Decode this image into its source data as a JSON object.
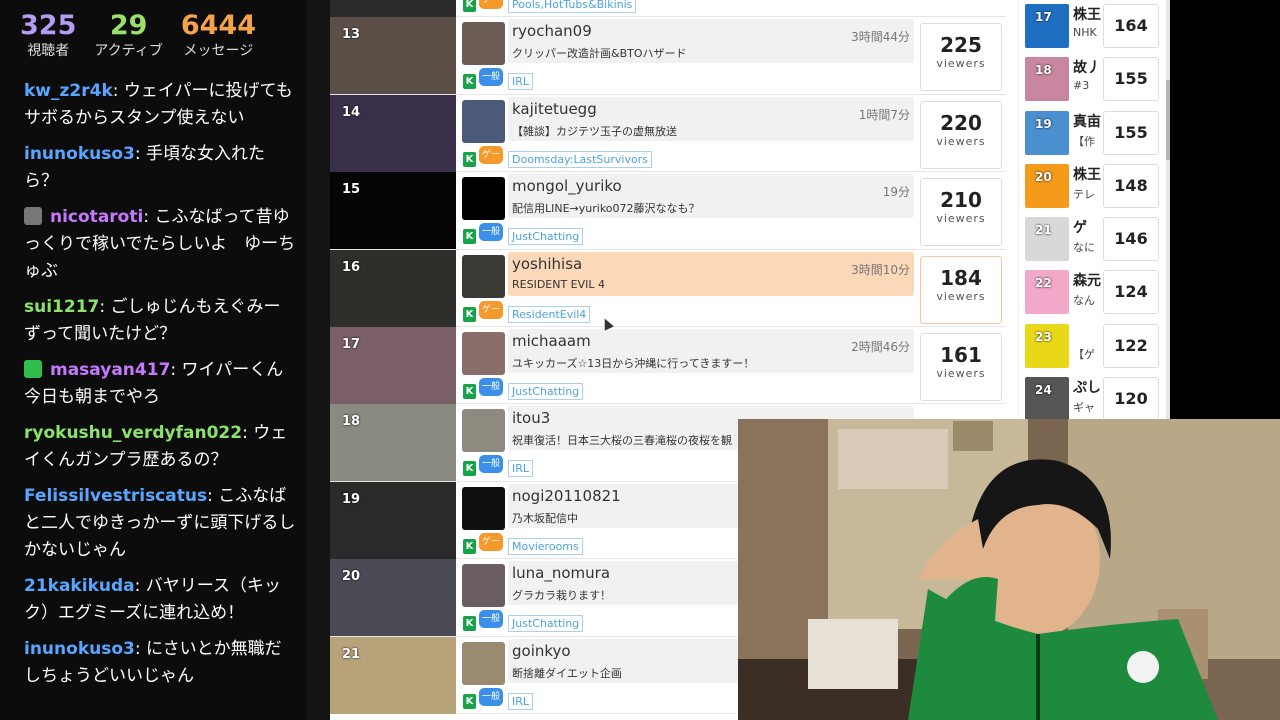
{
  "stats": [
    {
      "value": "325",
      "label": "視聴者",
      "color": "#b49cf2"
    },
    {
      "value": "29",
      "label": "アクティブ",
      "color": "#9be06a"
    },
    {
      "value": "6444",
      "label": "メッセージ",
      "color": "#f5a24b"
    }
  ],
  "chat": [
    {
      "user": "kw_z2r4k",
      "color": "#58a6ff",
      "text": "ウェイパーに投げてもサボるからスタンプ使えない"
    },
    {
      "user": "inunokuso3",
      "color": "#58a6ff",
      "text": "手頃な女入れたら？"
    },
    {
      "user": "nicotaroti",
      "color": "#c678ff",
      "text": "こふなばって昔ゆっくりで稼いでたらしいよ　ゆーちゅぶ",
      "icon": "avatar-icon"
    },
    {
      "user": "sui1217",
      "color": "#8be36a",
      "text": "ごしゅじんもえぐみーずって聞いたけど？"
    },
    {
      "user": "masayan417",
      "color": "#c678ff",
      "text": "ワイパーくん今日も朝までやろ",
      "icon": "gift-icon"
    },
    {
      "user": "ryokushu_verdyfan022",
      "color": "#8be36a",
      "text": "ウェイくんガンプラ歴あるの？"
    },
    {
      "user": "Felissilvestriscatus",
      "color": "#58a6ff",
      "text": "こふなばと二人でゆきっかーずに頭下げるしかないじゃん"
    },
    {
      "user": "21kakikuda",
      "color": "#58a6ff",
      "text": "バヤリース（キック）エグミーズに連れ込め！"
    },
    {
      "user": "inunokuso3",
      "color": "#58a6ff",
      "text": "にさいとか無職だしちょうどいいじゃん"
    }
  ],
  "streams": [
    {
      "rank": "",
      "name": "",
      "title": "",
      "duration": "",
      "tag": "Pools,HotTubs&Bikinis",
      "cat": "ゲーム",
      "cat_color": "orange",
      "viewers": "",
      "thumb": "#2b2b2b",
      "avatar": "#7a6455",
      "highlight": false
    },
    {
      "rank": "13",
      "name": "ryochan09",
      "title": "クリッパー改造計画&BTOハザード",
      "duration": "3時間44分",
      "tag": "IRL",
      "cat": "一般",
      "cat_color": "blue",
      "viewers": "225",
      "thumb": "#5c4f48",
      "avatar": "#6b5c55",
      "highlight": false
    },
    {
      "rank": "14",
      "name": "kajitetuegg",
      "title": "【雑談】カジテツ玉子の虚無放送",
      "duration": "1時間7分",
      "tag": "Doomsday:LastSurvivors",
      "cat": "ゲーム",
      "cat_color": "orange",
      "viewers": "220",
      "thumb": "#3a2f4a",
      "avatar": "#4a5a78",
      "highlight": false
    },
    {
      "rank": "15",
      "name": "mongol_yuriko",
      "title": "配信用LINE→yuriko072藤沢ななも？",
      "duration": "19分",
      "tag": "JustChatting",
      "cat": "一般",
      "cat_color": "blue",
      "viewers": "210",
      "thumb": "#050505",
      "avatar": "#000000",
      "highlight": false
    },
    {
      "rank": "16",
      "name": "yoshihisa",
      "title": "RESIDENT EVIL 4",
      "duration": "3時間10分",
      "tag": "ResidentEvil4",
      "cat": "ゲーム",
      "cat_color": "orange",
      "viewers": "184",
      "thumb": "#2e2e2a",
      "avatar": "#3a3a35",
      "highlight": true
    },
    {
      "rank": "17",
      "name": "michaaam",
      "title": "ユキッカーズ☆13日から沖縄に行ってきますー！",
      "duration": "2時間46分",
      "tag": "JustChatting",
      "cat": "一般",
      "cat_color": "blue",
      "viewers": "161",
      "thumb": "#7a5f66",
      "avatar": "#8a6e6a",
      "highlight": false
    },
    {
      "rank": "18",
      "name": "itou3",
      "title": "祝車復活！日本三大桜の三春滝桜の夜桜を観",
      "duration": "",
      "tag": "IRL",
      "cat": "一般",
      "cat_color": "blue",
      "viewers": "",
      "thumb": "#8a8a80",
      "avatar": "#8e8a80",
      "highlight": false
    },
    {
      "rank": "19",
      "name": "nogi20110821",
      "title": "乃木坂配信中",
      "duration": "",
      "tag": "Movierooms",
      "cat": "ゲーム",
      "cat_color": "orange",
      "viewers": "",
      "thumb": "#2a2a2a",
      "avatar": "#101010",
      "highlight": false
    },
    {
      "rank": "20",
      "name": "luna_nomura",
      "title": "グラカラ栽ります！",
      "duration": "",
      "tag": "JustChatting",
      "cat": "一般",
      "cat_color": "blue",
      "viewers": "",
      "thumb": "#4a4a55",
      "avatar": "#6a5e60",
      "highlight": false
    },
    {
      "rank": "21",
      "name": "goinkyo",
      "title": "断捨離ダイエット企画",
      "duration": "",
      "tag": "IRL",
      "cat": "一般",
      "cat_color": "blue",
      "viewers": "",
      "thumb": "#b8a27a",
      "avatar": "#9a8a70",
      "highlight": false
    }
  ],
  "side": [
    {
      "rank": "17",
      "name": "株王",
      "sub": "NHK",
      "viewers": "164",
      "color": "#1e6fc1"
    },
    {
      "rank": "18",
      "name": "故丿",
      "sub": "#3",
      "viewers": "155",
      "color": "#c986a0"
    },
    {
      "rank": "19",
      "name": "真亩",
      "sub": "【作",
      "viewers": "155",
      "color": "#4a8fd0"
    },
    {
      "rank": "20",
      "name": "株王",
      "sub": "テレ",
      "viewers": "148",
      "color": "#f59a1a"
    },
    {
      "rank": "21",
      "name": "ゲ",
      "sub": "なに",
      "viewers": "146",
      "color": "#d8d8d8"
    },
    {
      "rank": "22",
      "name": "森元",
      "sub": "なん",
      "viewers": "124",
      "color": "#f2a8c8"
    },
    {
      "rank": "23",
      "name": "",
      "sub": "【ゲ",
      "viewers": "122",
      "color": "#e8d818"
    },
    {
      "rank": "24",
      "name": "ぷし",
      "sub": "ギャ",
      "viewers": "120",
      "color": "#555"
    }
  ],
  "viewers_label": "viewers",
  "kick_badge": "K"
}
